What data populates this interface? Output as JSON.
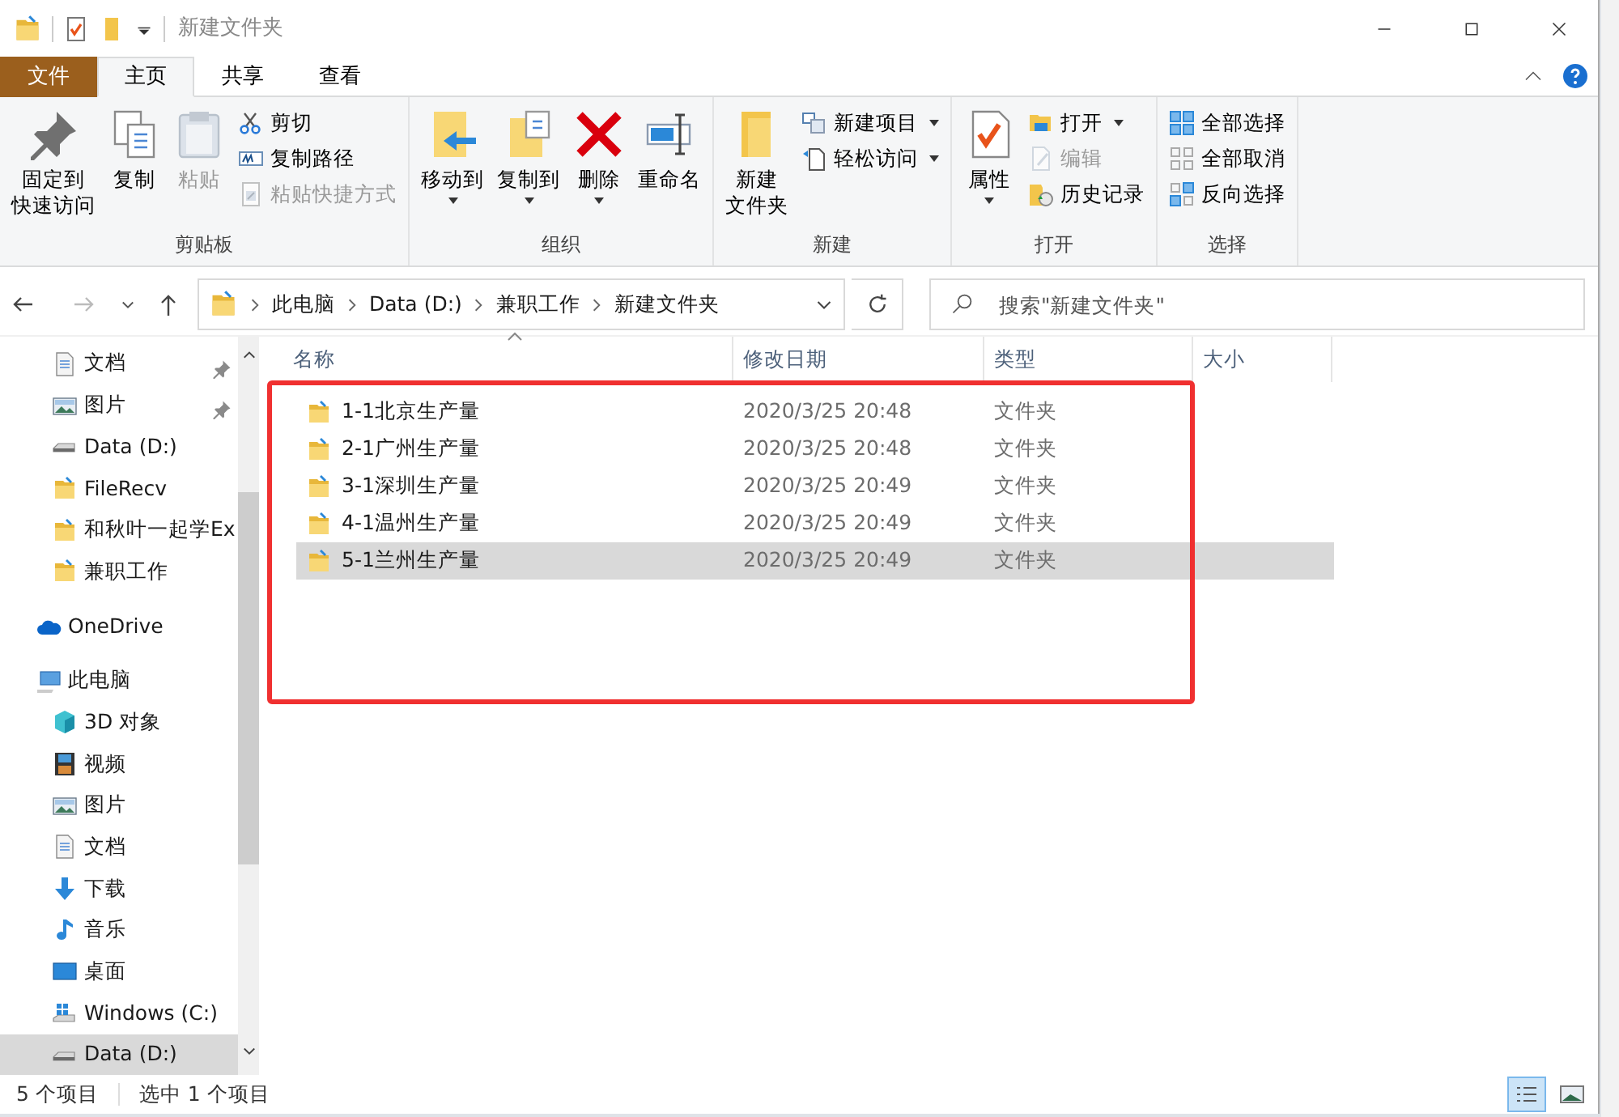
{
  "window": {
    "title": "新建文件夹"
  },
  "ribbon_tabs": [
    {
      "label": "文件",
      "kind": "file",
      "selected": false
    },
    {
      "label": "主页",
      "kind": "tab",
      "selected": true
    },
    {
      "label": "共享",
      "kind": "tab",
      "selected": false
    },
    {
      "label": "查看",
      "kind": "tab",
      "selected": false
    }
  ],
  "ribbon_groups": [
    {
      "label": "剪贴板",
      "items": [
        {
          "kind": "large",
          "label": [
            "固定到",
            "快速访问"
          ],
          "disabled": false,
          "dropdown": false
        },
        {
          "kind": "large",
          "label": [
            "复制"
          ],
          "disabled": false,
          "dropdown": false
        },
        {
          "kind": "large",
          "label": [
            "粘贴"
          ],
          "disabled": true,
          "dropdown": false
        },
        {
          "kind": "small",
          "label": [
            "剪切"
          ],
          "disabled": false,
          "dropdown": false
        },
        {
          "kind": "small",
          "label": [
            "复制路径"
          ],
          "disabled": false,
          "dropdown": false
        },
        {
          "kind": "small",
          "label": [
            "粘贴快捷方式"
          ],
          "disabled": true,
          "dropdown": false
        }
      ]
    },
    {
      "label": "组织",
      "items": [
        {
          "kind": "large",
          "label": [
            "移动到"
          ],
          "disabled": false,
          "dropdown": true
        },
        {
          "kind": "large",
          "label": [
            "复制到"
          ],
          "disabled": false,
          "dropdown": true
        },
        {
          "kind": "large",
          "label": [
            "删除"
          ],
          "disabled": false,
          "dropdown": true
        },
        {
          "kind": "large",
          "label": [
            "重命名"
          ],
          "disabled": false,
          "dropdown": false
        }
      ]
    },
    {
      "label": "新建",
      "items": [
        {
          "kind": "large",
          "label": [
            "新建",
            "文件夹"
          ],
          "disabled": false,
          "dropdown": false
        },
        {
          "kind": "small",
          "label": [
            "新建项目"
          ],
          "disabled": false,
          "dropdown": true
        },
        {
          "kind": "small",
          "label": [
            "轻松访问"
          ],
          "disabled": false,
          "dropdown": true
        }
      ]
    },
    {
      "label": "打开",
      "items": [
        {
          "kind": "large",
          "label": [
            "属性"
          ],
          "disabled": false,
          "dropdown": true
        },
        {
          "kind": "small",
          "label": [
            "打开"
          ],
          "disabled": false,
          "dropdown": true
        },
        {
          "kind": "small",
          "label": [
            "编辑"
          ],
          "disabled": true,
          "dropdown": false
        },
        {
          "kind": "small",
          "label": [
            "历史记录"
          ],
          "disabled": false,
          "dropdown": false
        }
      ]
    },
    {
      "label": "选择",
      "items": [
        {
          "kind": "small",
          "label": [
            "全部选择"
          ],
          "disabled": false,
          "dropdown": false
        },
        {
          "kind": "small",
          "label": [
            "全部取消"
          ],
          "disabled": false,
          "dropdown": false
        },
        {
          "kind": "small",
          "label": [
            "反向选择"
          ],
          "disabled": false,
          "dropdown": false
        }
      ]
    }
  ],
  "address": {
    "path": [
      "此电脑",
      "Data (D:)",
      "兼职工作",
      "新建文件夹"
    ]
  },
  "search": {
    "placeholder": "搜索\"新建文件夹\""
  },
  "sidebar": {
    "continued_items": [
      {
        "label": "文档",
        "pinned": true,
        "selected": false
      },
      {
        "label": "图片",
        "pinned": true,
        "selected": false
      },
      {
        "label": "Data (D:)",
        "pinned": false,
        "selected": false
      },
      {
        "label": "FileRecv",
        "pinned": false,
        "selected": false
      },
      {
        "label": "和秋叶一起学Ex",
        "pinned": false,
        "selected": false
      },
      {
        "label": "兼职工作",
        "pinned": false,
        "selected": false
      }
    ],
    "items": [
      {
        "label": "OneDrive",
        "pinned": false,
        "selected": false
      },
      {
        "label": "此电脑",
        "pinned": false,
        "selected": false,
        "children": [
          {
            "label": "3D 对象",
            "pinned": false,
            "selected": false
          },
          {
            "label": "视频",
            "pinned": false,
            "selected": false
          },
          {
            "label": "图片",
            "pinned": false,
            "selected": false
          },
          {
            "label": "文档",
            "pinned": false,
            "selected": false
          },
          {
            "label": "下载",
            "pinned": false,
            "selected": false
          },
          {
            "label": "音乐",
            "pinned": false,
            "selected": false
          },
          {
            "label": "桌面",
            "pinned": false,
            "selected": false
          },
          {
            "label": "Windows (C:)",
            "pinned": false,
            "selected": false
          },
          {
            "label": "Data (D:)",
            "pinned": false,
            "selected": true
          }
        ]
      }
    ]
  },
  "table": {
    "columns": [
      "名称",
      "修改日期",
      "类型",
      "大小"
    ],
    "rows": [
      {
        "name": "1-1北京生产量",
        "modified": "2020/3/25 20:48",
        "type": "文件夹",
        "selected": false
      },
      {
        "name": "2-1广州生产量",
        "modified": "2020/3/25 20:48",
        "type": "文件夹",
        "selected": false
      },
      {
        "name": "3-1深圳生产量",
        "modified": "2020/3/25 20:49",
        "type": "文件夹",
        "selected": false
      },
      {
        "name": "4-1温州生产量",
        "modified": "2020/3/25 20:49",
        "type": "文件夹",
        "selected": false
      },
      {
        "name": "5-1兰州生产量",
        "modified": "2020/3/25 20:49",
        "type": "文件夹",
        "selected": true
      }
    ]
  },
  "annotation": {
    "kind": "highlight-box"
  },
  "status_bar": {
    "item_count": "5 个项目",
    "selection": "选中 1 个项目",
    "view_buttons": [
      {
        "kind": "details",
        "selected": true
      },
      {
        "kind": "large-icons",
        "selected": false
      }
    ]
  }
}
